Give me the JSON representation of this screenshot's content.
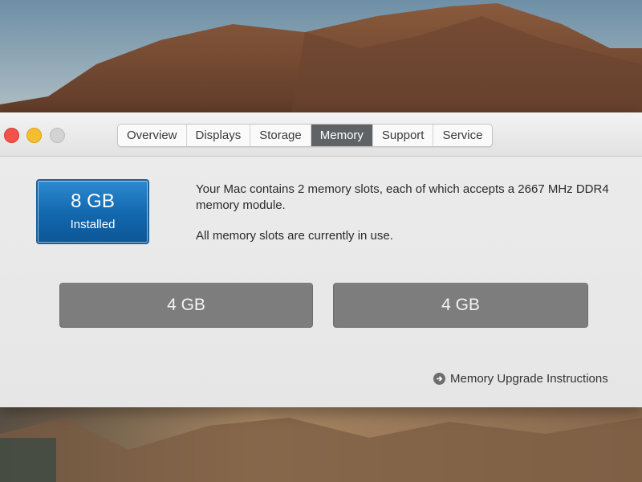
{
  "tabs": [
    {
      "label": "Overview",
      "active": false
    },
    {
      "label": "Displays",
      "active": false
    },
    {
      "label": "Storage",
      "active": false
    },
    {
      "label": "Memory",
      "active": true
    },
    {
      "label": "Support",
      "active": false
    },
    {
      "label": "Service",
      "active": false
    }
  ],
  "memory": {
    "installed_size": "8 GB",
    "installed_label": "Installed",
    "description_line1": "Your Mac contains 2 memory slots, each of which accepts a 2667 MHz DDR4 memory module.",
    "description_line2": "All memory slots are currently in use.",
    "slots": [
      "4 GB",
      "4 GB"
    ],
    "upgrade_link": "Memory Upgrade Instructions"
  },
  "icons": {
    "close": "close-button-icon",
    "minimize": "minimize-button-icon",
    "zoom": "zoom-button-icon",
    "link_arrow": "arrow-right-circle-icon"
  },
  "colors": {
    "active_tab": "#5f6366",
    "installed_badge": "#1a74bb",
    "slot_fill": "#7d7d7d",
    "close": "#f2524a",
    "minimize": "#f6be2f"
  }
}
